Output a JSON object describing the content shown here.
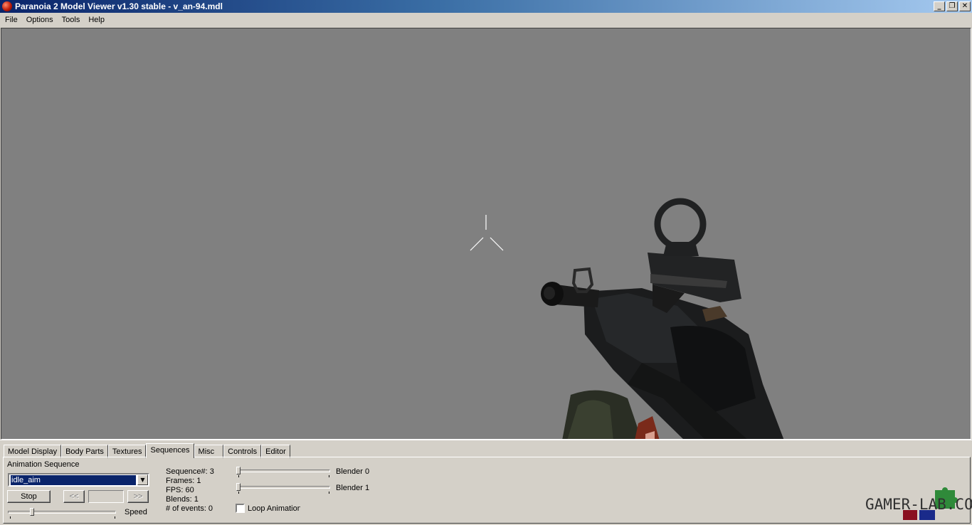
{
  "window": {
    "title": "Paranoia 2 Model Viewer v1.30 stable - v_an-94.mdl",
    "controls": {
      "minimize": "_",
      "restore": "❐",
      "close": "✕"
    }
  },
  "menu": [
    "File",
    "Options",
    "Tools",
    "Help"
  ],
  "viewport": {
    "background": "#808080"
  },
  "tabs": [
    "Model Display",
    "Body Parts",
    "Textures",
    "Sequences",
    "Misc",
    "Controls",
    "Editor"
  ],
  "active_tab": "Sequences",
  "sequences": {
    "animation_label": "Animation Sequence",
    "selected": "idle_aim",
    "stop_label": "Stop",
    "prev_label": "<<",
    "next_label": ">>",
    "speed_label": "Speed",
    "speed_level": 0.21,
    "info": {
      "sequence": "Sequence#: 3",
      "frames": "Frames: 1",
      "fps": "FPS: 60",
      "blends": "Blends: 1",
      "events": "# of events: 0"
    },
    "blender0_label": "Blender 0",
    "blender1_label": "Blender 1",
    "blender0_level": 0,
    "blender1_level": 0,
    "loop_label": "Loop Animation",
    "loop_checked": false
  },
  "watermark": {
    "text": "GAMER-LAB.COM",
    "icon": "puzzle-piece-icon"
  },
  "colors": {
    "titlebar_start": "#0a246a",
    "titlebar_end": "#a6caf0",
    "selection": "#0a246a",
    "face": "#d4d0c8"
  }
}
